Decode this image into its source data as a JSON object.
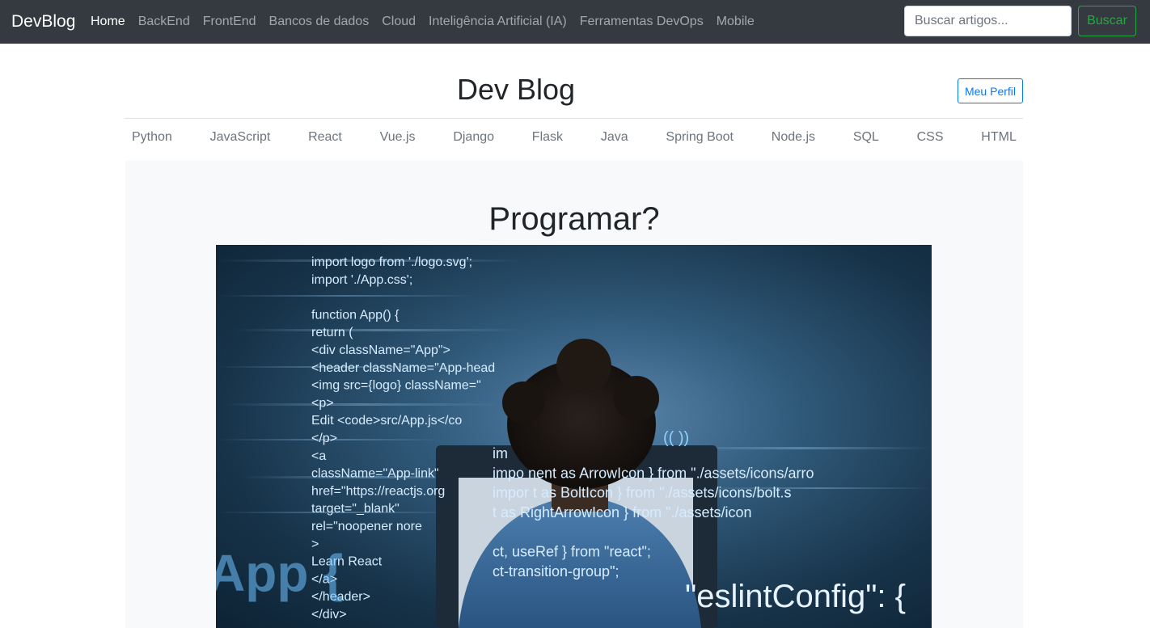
{
  "navbar": {
    "brand": "DevBlog",
    "links": [
      "Home",
      "BackEnd",
      "FrontEnd",
      "Bancos de dados",
      "Cloud",
      "Inteligência Artificial (IA)",
      "Ferramentas DevOps",
      "Mobile"
    ],
    "active_index": 0,
    "search_placeholder": "Buscar artigos...",
    "search_button": "Buscar"
  },
  "header": {
    "title": "Dev Blog",
    "profile_button": "Meu Perfil"
  },
  "categories": [
    "Python",
    "JavaScript",
    "React",
    "Vue.js",
    "Django",
    "Flask",
    "Java",
    "Spring Boot",
    "Node.js",
    "SQL",
    "CSS",
    "HTML"
  ],
  "post": {
    "title": "Programar?",
    "image": {
      "code_left": [
        "import logo from './logo.svg';",
        "import './App.css';",
        "",
        "function App() {",
        "  return (",
        "    <div className=\"App\">",
        "      <header className=\"App-head",
        "        <img src={logo} className=\"",
        "        <p>",
        "          Edit <code>src/App.js</co",
        "        </p>",
        "        <a",
        "          className=\"App-link\"",
        "          href=\"https://reactjs.org",
        "          target=\"_blank\"",
        "          rel=\"noopener nore",
        "        >",
        "          Learn React",
        "        </a>",
        "      </header>",
        "    </div>"
      ],
      "code_right": [
        "im",
        "impo                nent as ArrowIcon } from \"./assets/icons/arro",
        "impor               t as BoltIcon } from \"./assets/icons/bolt.s",
        "                    t as RightArrowIcon } from \"./assets/icon",
        "",
        "ct, useRef } from \"react\";",
        "ct-transition-group\";"
      ],
      "big_left": "App {",
      "big_right": "\"eslintConfig\": {",
      "parens": "((          ))",
      "colors": {
        "code": "#d6ecff",
        "glow": "#6fc3ff"
      }
    }
  }
}
